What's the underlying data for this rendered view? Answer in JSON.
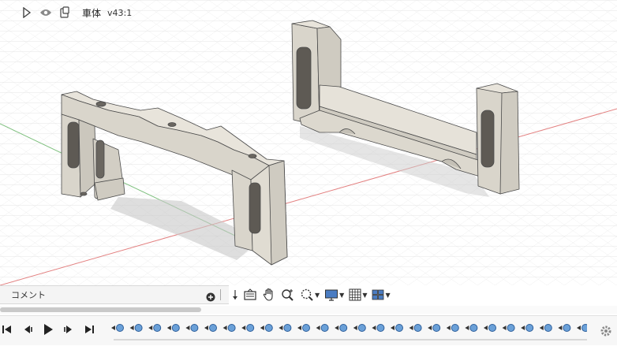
{
  "document": {
    "name": "車体",
    "version": "v43:1"
  },
  "comments": {
    "label": "コメント"
  },
  "toolbar": {
    "items": [
      "orbit-icon",
      "look-at-icon",
      "pan-icon",
      "zoom-icon",
      "fit-icon",
      "display-settings-icon",
      "grid-settings-icon",
      "viewports-icon"
    ]
  },
  "timeline": {
    "controls": [
      "go-to-start-icon",
      "step-back-icon",
      "play-icon",
      "step-forward-icon",
      "go-to-end-icon"
    ],
    "feature_count": 26
  },
  "colors": {
    "part_face": "#e3dfd6",
    "part_side": "#cfcbc1",
    "part_shadow": "#b9b5ab",
    "edge": "#3a3a3a",
    "grid": "#d6d6d6",
    "axis_x": "#e06060",
    "axis_y": "#60b060",
    "timeline_marker": "#6aa0d8"
  }
}
